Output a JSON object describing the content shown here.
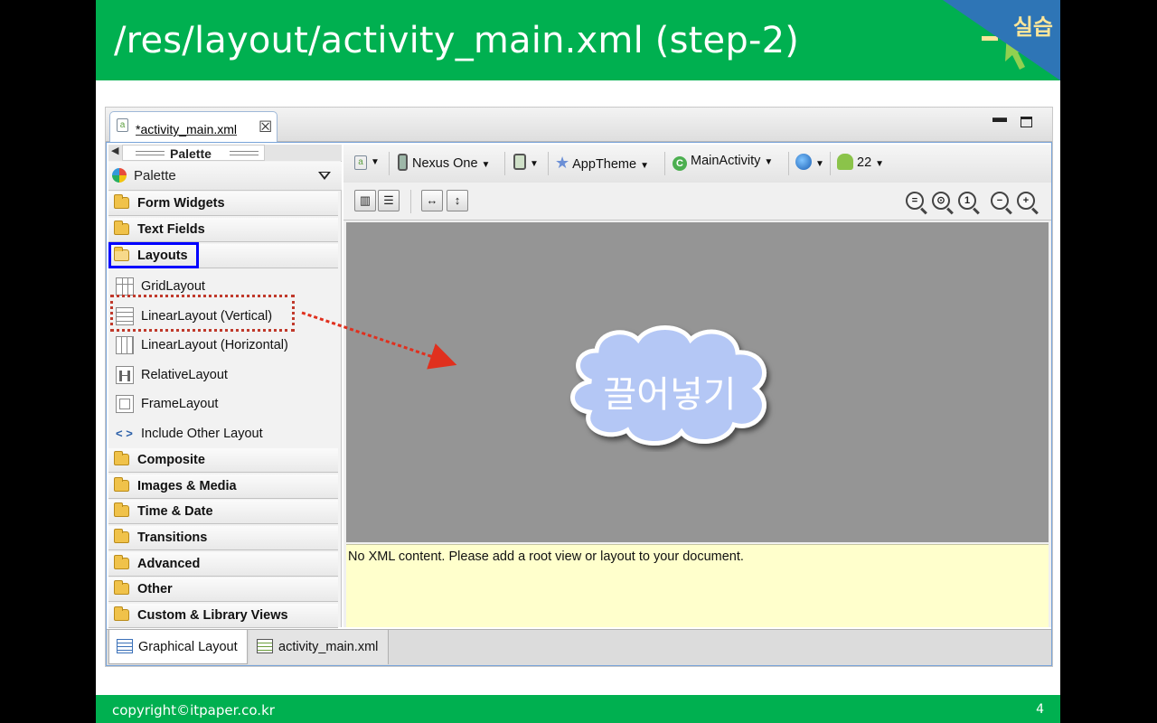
{
  "slide": {
    "title": "/res/layout/activity_main.xml  (step-2)",
    "badge": "실습",
    "footer": "copyright©itpaper.co.kr",
    "page_number": "4"
  },
  "editor": {
    "tab_label": "*activity_main.xml"
  },
  "palette": {
    "header": "Palette",
    "select_label": "Palette",
    "categories": [
      {
        "label": "Form Widgets"
      },
      {
        "label": "Text Fields"
      },
      {
        "label": "Layouts"
      },
      {
        "label": "Composite"
      },
      {
        "label": "Images & Media"
      },
      {
        "label": "Time & Date"
      },
      {
        "label": "Transitions"
      },
      {
        "label": "Advanced"
      },
      {
        "label": "Other"
      },
      {
        "label": "Custom & Library Views"
      }
    ],
    "layout_items": [
      {
        "label": "GridLayout",
        "icon": "grid-layout-icon"
      },
      {
        "label": "LinearLayout (Vertical)",
        "icon": "linear-vertical-icon"
      },
      {
        "label": "LinearLayout (Horizontal)",
        "icon": "linear-horizontal-icon"
      },
      {
        "label": "RelativeLayout",
        "icon": "relative-layout-icon"
      },
      {
        "label": "FrameLayout",
        "icon": "frame-layout-icon"
      },
      {
        "label": "Include Other Layout",
        "icon": "include-layout-icon"
      }
    ]
  },
  "toolbar": {
    "device": "Nexus One",
    "theme": "AppTheme",
    "activity": "MainActivity",
    "api_level": "22"
  },
  "design": {
    "message": "No XML content. Please add a root view or layout to your document."
  },
  "bottom_tabs": {
    "graphical": "Graphical Layout",
    "xml": "activity_main.xml"
  },
  "annotation": {
    "cloud_text": "끌어넣기"
  },
  "colors": {
    "title_bar": "#00b050",
    "badge": "#2e75b6",
    "highlight": "#0000ff",
    "dashed": "#c0392b",
    "cloud": "#b4c7f5"
  }
}
